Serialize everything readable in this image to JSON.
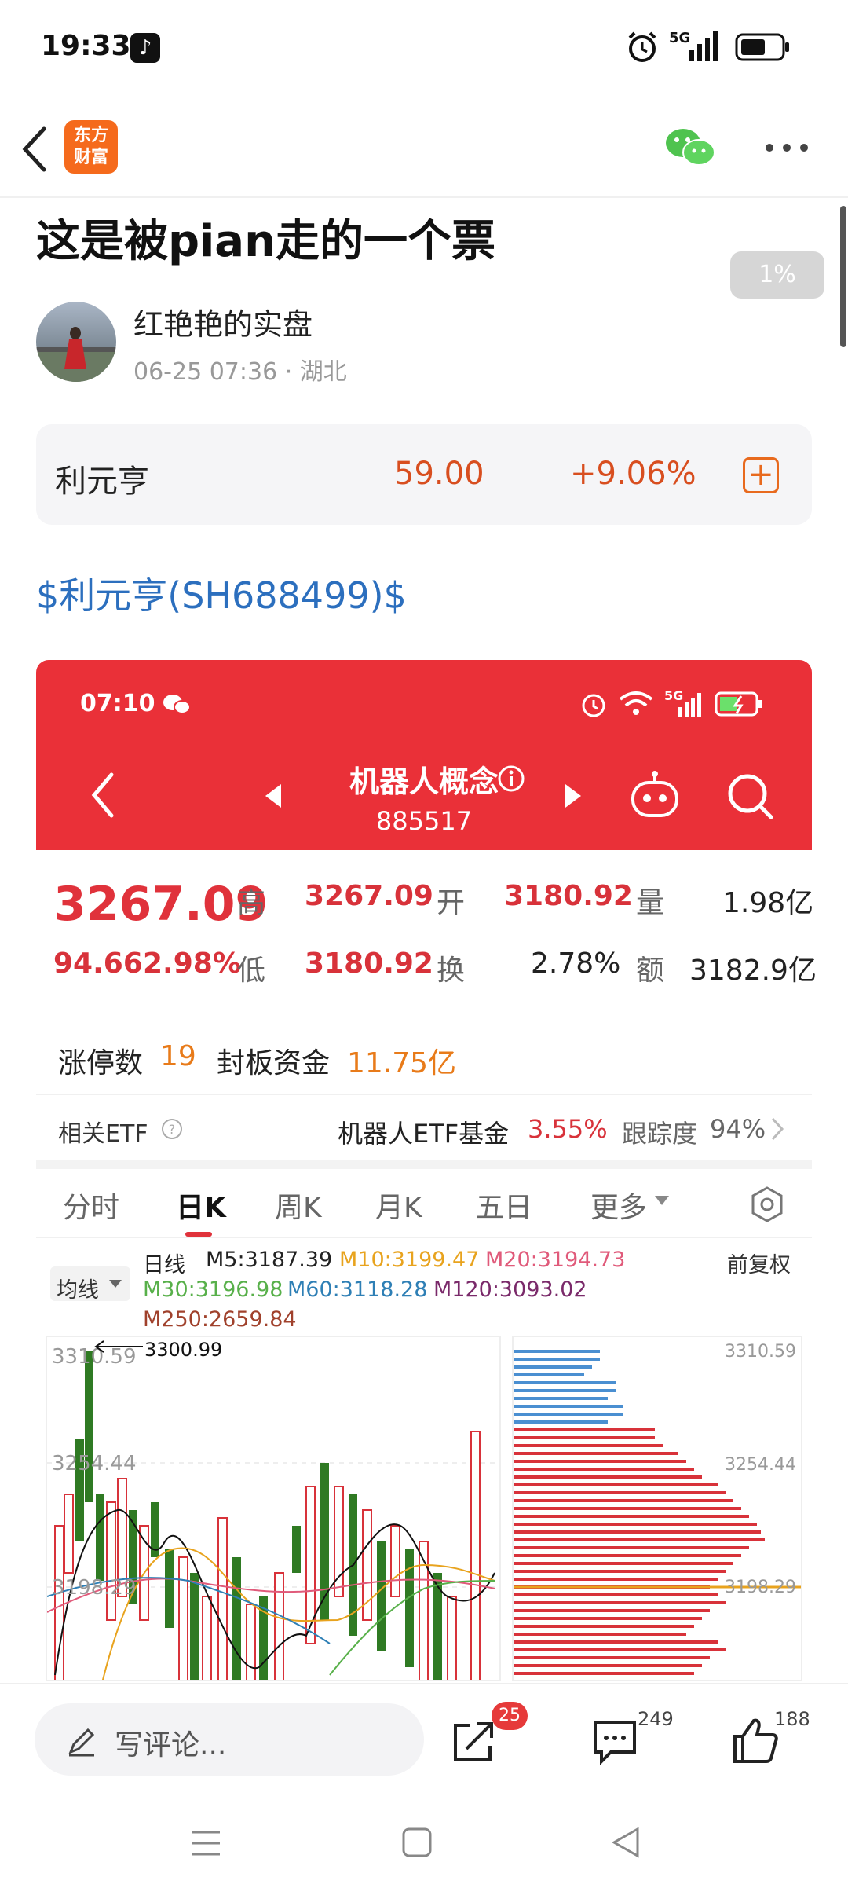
{
  "status_bar": {
    "time": "19:33",
    "network": "5G"
  },
  "header": {
    "app_logo_line1": "东方",
    "app_logo_line2": "财富"
  },
  "post": {
    "title": "这是被pian走的一个票",
    "progress_badge": "1%",
    "author": "红艳艳的实盘",
    "meta": "06-25 07:36 · 湖北",
    "stock_link": "$利元亨(SH688499)$"
  },
  "stock_card": {
    "name": "利元亨",
    "price": "59.00",
    "change": "+9.06%"
  },
  "screenshot": {
    "time": "07:10",
    "network": "5G",
    "title": "机器人概念",
    "code": "885517",
    "price": "3267.09",
    "change_abs": "94.66",
    "change_pct": "2.98%",
    "high_label": "高",
    "high": "3267.09",
    "open_label": "开",
    "open": "3180.92",
    "vol_label": "量",
    "vol": "1.98亿",
    "low_label": "低",
    "low": "3180.92",
    "turnover_label": "换",
    "turnover": "2.78%",
    "amount_label": "额",
    "amount": "3182.9亿",
    "limit_up_label": "涨停数",
    "limit_up": "19",
    "seal_label": "封板资金",
    "seal": "11.75亿",
    "etf_label": "相关ETF",
    "etf_name": "机器人ETF基金",
    "etf_chg": "3.55%",
    "track_label": "跟踪度",
    "track": "94%",
    "tabs": [
      "分时",
      "日K",
      "周K",
      "月K",
      "五日",
      "更多"
    ],
    "ma_select": "均线",
    "ma_row1": {
      "type": "日线",
      "m5": "M5:3187.39",
      "m10": "M10:3199.47",
      "m20": "M20:3194.73"
    },
    "ma_row2": {
      "m30": "M30:3196.98",
      "m60": "M60:3118.28",
      "m120": "M120:3093.02"
    },
    "ma_row3": {
      "m250": "M250:2659.84"
    },
    "adjust": "前复权",
    "peak_label": "3300.99",
    "y_ticks": [
      "3310.59",
      "3254.44",
      "3198.29"
    ],
    "right_ticks": [
      "3310.59",
      "3254.44",
      "3198.29"
    ]
  },
  "bottom_bar": {
    "comment_placeholder": "写评论...",
    "share_count": "25",
    "comment_count": "249",
    "like_count": "188"
  },
  "colors": {
    "red": "#ea3038",
    "orange": "#e87b1a",
    "link": "#2c6fbe"
  }
}
